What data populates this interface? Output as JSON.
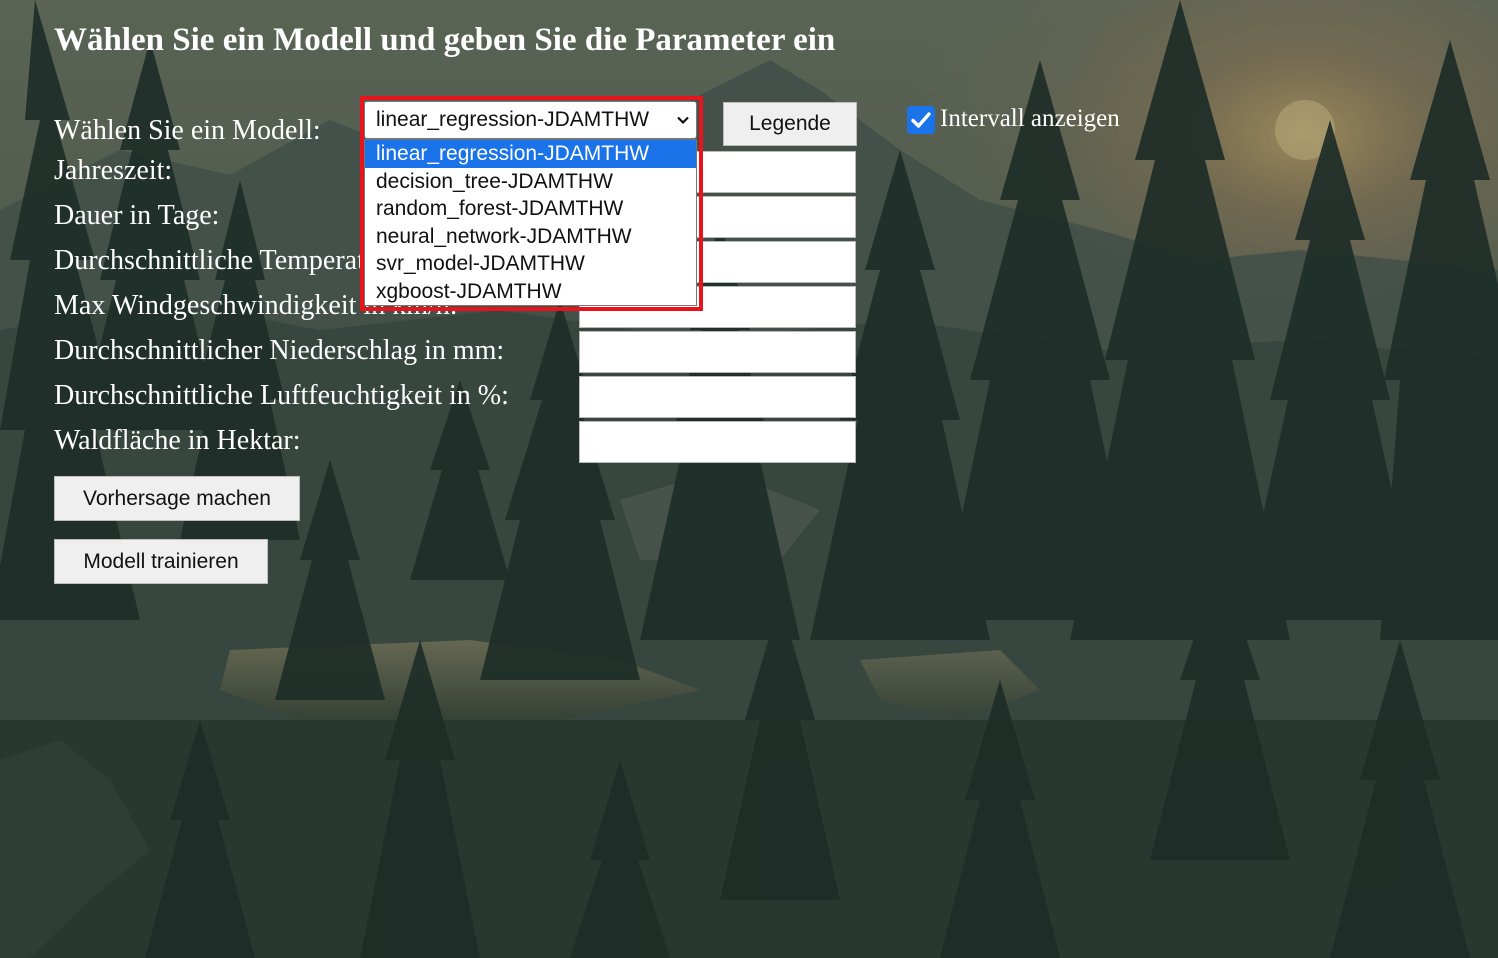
{
  "page_title": "Wählen Sie ein Modell und geben Sie die Parameter ein",
  "model_selector": {
    "label": "Wählen Sie ein Modell:",
    "selected_value": "linear_regression-JDAMTHW",
    "options": [
      "linear_regression-JDAMTHW",
      "decision_tree-JDAMTHW",
      "random_forest-JDAMTHW",
      "neural_network-JDAMTHW",
      "svr_model-JDAMTHW",
      "xgboost-JDAMTHW"
    ],
    "highlight_color": "#e8141b",
    "selected_option_color": "#1a73e8"
  },
  "legend_button": "Legende",
  "interval_checkbox": {
    "label": "Intervall anzeigen",
    "checked": true,
    "color": "#1a73e8"
  },
  "fields": [
    {
      "label": "Jahreszeit:",
      "value": ""
    },
    {
      "label": "Dauer in Tage:",
      "value": ""
    },
    {
      "label": "Durchschnittliche Temperatur in °C:",
      "value": ""
    },
    {
      "label": "Max Windgeschwindigkeit in km/h:",
      "value": ""
    },
    {
      "label": "Durchschnittlicher Niederschlag in mm:",
      "value": ""
    },
    {
      "label": "Durchschnittliche Luftfeuchtigkeit in %:",
      "value": ""
    },
    {
      "label": "Waldfläche in Hektar:",
      "value": ""
    }
  ],
  "buttons": {
    "predict": "Vorhersage machen",
    "train": "Modell trainieren"
  }
}
